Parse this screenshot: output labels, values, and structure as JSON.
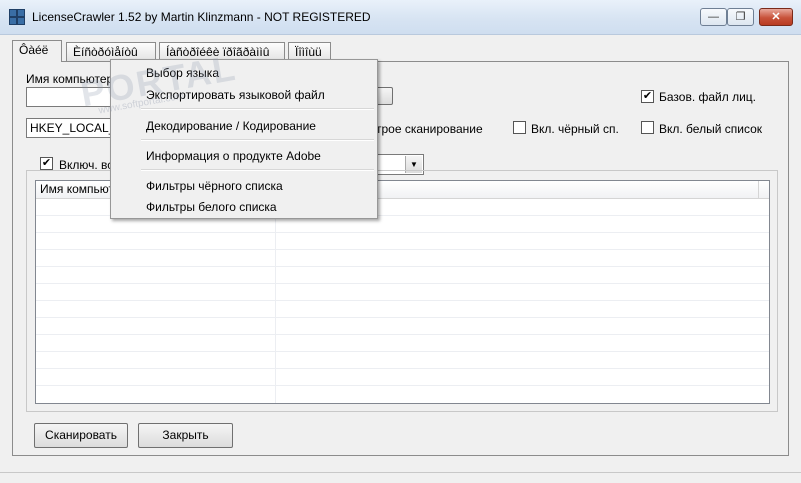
{
  "window": {
    "title": "LicenseCrawler 1.52 by Martin Klinzmann - NOT REGISTERED",
    "min_label": "—",
    "max_label": "❐",
    "close_label": "✕"
  },
  "tabs": [
    {
      "label": "Ôàéë"
    },
    {
      "label": "Èíñòðóìåíòû"
    },
    {
      "label": "Íàñòðîéêè ïðîãðàììû"
    },
    {
      "label": "Ïîìîùü"
    }
  ],
  "form": {
    "computer_name_label": "Имя компьютера",
    "computer_name_value": "",
    "registry_key_value": "HKEY_LOCAL_M",
    "fast_scan_label": "строе сканирование",
    "base_license_file_label": "Базов. файл лиц.",
    "base_license_file_checked": "✔",
    "blacklist_label": "Вкл. чёрный сп.",
    "whitelist_label": "Вкл. белый список",
    "include_all_label": "Включ. всё",
    "include_all_checked": "✔"
  },
  "list": {
    "columns": [
      "Имя компьют",
      ""
    ]
  },
  "buttons": {
    "scan": "Сканировать",
    "close": "Закрыть"
  },
  "menu": {
    "items": [
      "Выбор языка",
      "Экспортировать языковой файл",
      "Декодирование / Кодирование",
      "Информация о продукте Adobe",
      "Фильтры чёрного списка",
      "Фильтры белого списка"
    ]
  },
  "watermark": {
    "text": "PORTAL",
    "subtext": "www.softportal.com"
  },
  "colors": {
    "titlebar": "#d6e3f2",
    "close_button": "#c8523a",
    "background": "#f0f0f0"
  }
}
